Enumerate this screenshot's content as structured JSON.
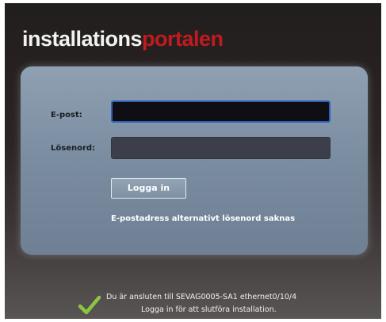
{
  "header": {
    "logo_part1": "installations",
    "logo_part2": "portalen"
  },
  "login_form": {
    "email_label": "E-post:",
    "email_value": "",
    "password_label": "Lösenord:",
    "password_value": "",
    "login_button": "Logga in",
    "forgot_link": "E-postadress alternativt lösenord saknas"
  },
  "status": {
    "icon": "checkmark-icon",
    "line1": "Du är ansluten till SEVAG0005-SA1 ethernet0/10/4",
    "line2": "Logga in för att slutföra installation."
  },
  "colors": {
    "logo_white": "#f2f2f2",
    "logo_red": "#c11a1f",
    "panel": "#7a8ca0",
    "focus_border": "#2f5fb8",
    "check_green": "#8cc63f"
  }
}
